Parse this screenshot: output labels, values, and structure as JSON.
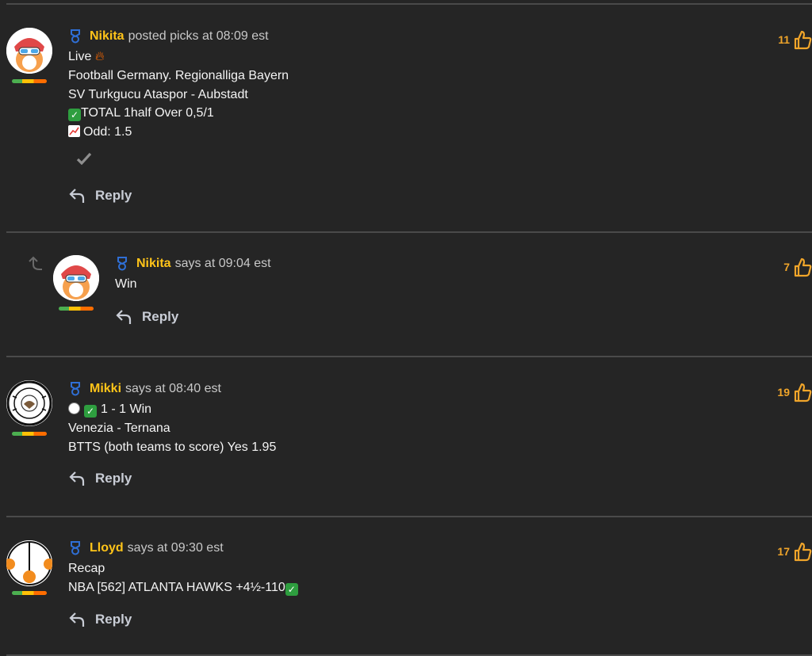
{
  "comments": [
    {
      "author": "Nikita",
      "meta": "posted picks at 08:09 est",
      "lines": [
        "Live",
        "Football Germany. Regionalliga Bayern",
        "SV Turkgucu Ataspor - Aubstadt",
        "TOTAL 1half Over  0,5/1",
        "Odd: 1.5"
      ],
      "reply_label": "Reply",
      "likes": "11"
    },
    {
      "author": "Nikita",
      "meta": "says at 09:04 est",
      "lines": [
        "Win"
      ],
      "reply_label": "Reply",
      "likes": "7"
    },
    {
      "author": "Mikki",
      "meta": "says at 08:40 est",
      "lines": [
        "1 - 1 Win",
        "Venezia - Ternana",
        "BTTS (both teams to score) Yes 1.95"
      ],
      "reply_label": "Reply",
      "likes": "19"
    },
    {
      "author": "Lloyd",
      "meta": "says at 09:30 est",
      "lines": [
        "Recap",
        "NBA [562] ATLANTA HAWKS +4½-110"
      ],
      "reply_label": "Reply",
      "likes": "17"
    }
  ],
  "colors": {
    "background": "#252525",
    "author": "#ffc419",
    "likes": "#f0a52a",
    "medal": "#2f6fd6"
  },
  "icons": [
    "medal-icon",
    "thumbs-up-icon",
    "reply-arrow-icon",
    "fire-icon",
    "check-mark-icon",
    "chart-icon",
    "soccer-ball-icon",
    "nested-reply-arrow-icon"
  ]
}
